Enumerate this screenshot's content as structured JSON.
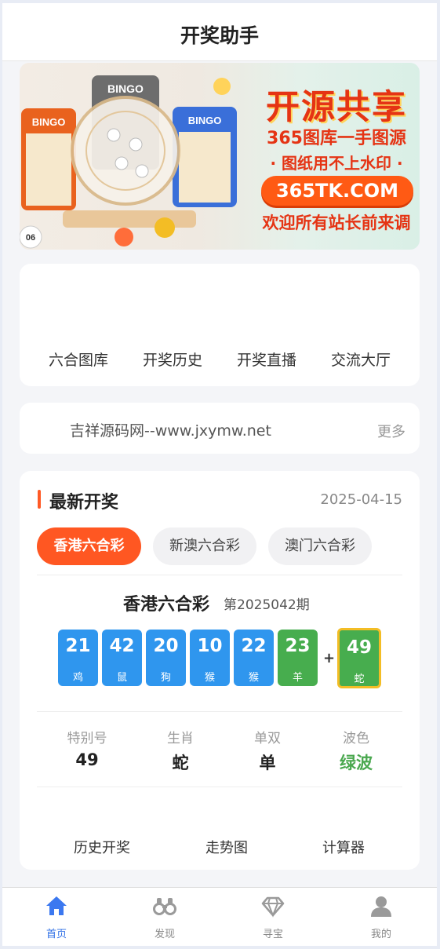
{
  "header": {
    "title": "开奖助手"
  },
  "banner": {
    "title": "开源共享",
    "line1": "365图库一手图源",
    "line2": "· 图纸用不上水印 ·",
    "site": "365TK.COM",
    "line3": "欢迎所有站长前来调",
    "card_labels": [
      "BINGO",
      "BINGO",
      "BINGO"
    ],
    "ball_label": "06"
  },
  "nav": {
    "items": [
      "六合图库",
      "开奖历史",
      "开奖直播",
      "交流大厅"
    ]
  },
  "notice": {
    "text": "吉祥源码网--www.jxymw.net",
    "more": "更多"
  },
  "latest": {
    "title": "最新开奖",
    "date": "2025-04-15",
    "tabs": [
      "香港六合彩",
      "新澳六合彩",
      "澳门六合彩"
    ],
    "draw_name": "香港六合彩",
    "period": "第2025042期",
    "balls": [
      {
        "num": "21",
        "zodiac": "鸡",
        "color": "blue"
      },
      {
        "num": "42",
        "zodiac": "鼠",
        "color": "blue"
      },
      {
        "num": "20",
        "zodiac": "狗",
        "color": "blue"
      },
      {
        "num": "10",
        "zodiac": "猴",
        "color": "blue"
      },
      {
        "num": "22",
        "zodiac": "猴",
        "color": "blue"
      },
      {
        "num": "23",
        "zodiac": "羊",
        "color": "green"
      }
    ],
    "plus": "+",
    "special": {
      "num": "49",
      "zodiac": "蛇",
      "color": "green"
    },
    "stats": [
      {
        "label": "特别号",
        "value": "49"
      },
      {
        "label": "生肖",
        "value": "蛇"
      },
      {
        "label": "单双",
        "value": "单"
      },
      {
        "label": "波色",
        "value": "绿波"
      }
    ],
    "tools": [
      "历史开奖",
      "走势图",
      "计算器"
    ]
  },
  "tabbar": {
    "items": [
      {
        "label": "首页",
        "icon": "home-icon",
        "active": true
      },
      {
        "label": "发现",
        "icon": "binoculars-icon",
        "active": false
      },
      {
        "label": "寻宝",
        "icon": "diamond-icon",
        "active": false
      },
      {
        "label": "我的",
        "icon": "user-icon",
        "active": false
      }
    ]
  },
  "colors": {
    "accent": "#ff5722",
    "blue_ball": "#2f96ee",
    "green_ball": "#47ad4e",
    "tab_active": "#2f6fe6"
  }
}
